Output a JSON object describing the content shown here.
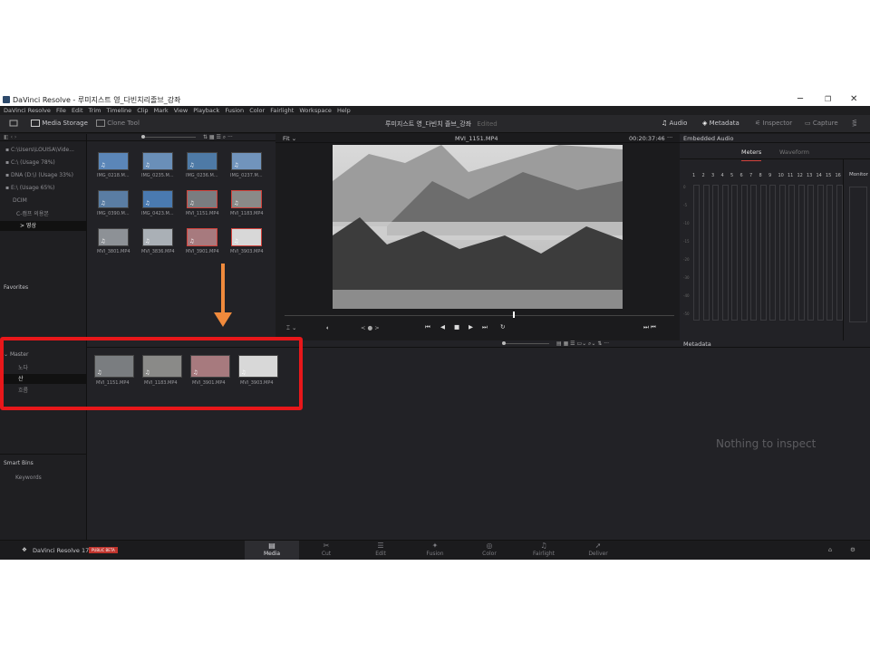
{
  "window": {
    "title": "DaVinci Resolve - 루미지스트 영_다빈치리졸브_강좌",
    "controls": {
      "minimize": "─",
      "maximize": "❐",
      "close": "✕"
    }
  },
  "menu": [
    "DaVinci Resolve",
    "File",
    "Edit",
    "Trim",
    "Timeline",
    "Clip",
    "Mark",
    "View",
    "Playback",
    "Fusion",
    "Color",
    "Fairlight",
    "Workspace",
    "Help"
  ],
  "toolbar": {
    "media_storage": "Media Storage",
    "clone_tool": "Clone Tool",
    "project_title": "루미지스트 영_다빈치 졸브_강좌",
    "edited": "Edited",
    "audio": "Audio",
    "metadata": "Metadata",
    "inspector": "Inspector",
    "capture": "Capture"
  },
  "storage_tree": [
    {
      "label": "C:\\Users\\LOUISA\\Vide...",
      "icon": "drive-icon"
    },
    {
      "label": "C:\\ (Usage 78%)",
      "icon": "drive-icon"
    },
    {
      "label": "DNA (D:\\) (Usage 33%)",
      "icon": "drive-icon"
    },
    {
      "label": "E:\\ (Usage 65%)",
      "icon": "drive-icon"
    },
    {
      "label": "DCIM",
      "icon": "folder-icon"
    },
    {
      "label": "C-캠프 의용본",
      "icon": "folder-icon"
    },
    {
      "label": "> 영상",
      "icon": "folder-icon"
    }
  ],
  "favorites_label": "Favorites",
  "media_files": [
    {
      "name": "IMG_0218.M...",
      "selected": false,
      "tone": "#5b86b8"
    },
    {
      "name": "IMG_0235.M...",
      "selected": false,
      "tone": "#6a8fb8"
    },
    {
      "name": "IMG_0236.M...",
      "selected": false,
      "tone": "#4e7aa6"
    },
    {
      "name": "IMG_0237.M...",
      "selected": false,
      "tone": "#7194bc"
    },
    {
      "name": "IMG_0390.M...",
      "selected": false,
      "tone": "#5a7da3"
    },
    {
      "name": "IMG_0423.M...",
      "selected": false,
      "tone": "#4a7ab0"
    },
    {
      "name": "MVI_1151.MP4",
      "selected": true,
      "tone": "#7a7d80"
    },
    {
      "name": "MVI_1183.MP4",
      "selected": true,
      "tone": "#8a8a88"
    },
    {
      "name": "MVI_3801.MP4",
      "selected": false,
      "tone": "#8d9196"
    },
    {
      "name": "MVI_3836.MP4",
      "selected": false,
      "tone": "#aab0b6"
    },
    {
      "name": "MVI_3901.MP4",
      "selected": true,
      "tone": "#a77a7e"
    },
    {
      "name": "MVI_3903.MP4",
      "selected": true,
      "tone": "#d8d8d8"
    }
  ],
  "viewer": {
    "fit": "Fit",
    "clip_name": "MVI_1151.MP4",
    "timecode": "00:20:37:46",
    "transport": [
      "⏮",
      "◀",
      "■",
      "▶",
      "⏭",
      "↻"
    ],
    "frame": "< ● >"
  },
  "audio_panel": {
    "title": "Embedded Audio",
    "tabs": [
      "Meters",
      "Waveform"
    ],
    "monitor": "Monitor",
    "channels": [
      "1",
      "2",
      "3",
      "4",
      "5",
      "6",
      "7",
      "8",
      "9",
      "10",
      "11",
      "12",
      "13",
      "14",
      "15",
      "16"
    ],
    "scale": [
      "0",
      "-5",
      "-10",
      "-15",
      "-20",
      "-30",
      "-40",
      "-50"
    ]
  },
  "bins": {
    "master": "Master",
    "children": [
      "노다",
      "산",
      "흐름"
    ]
  },
  "smart_bins": {
    "label": "Smart Bins",
    "keywords": "Keywords"
  },
  "bin_clips": [
    {
      "name": "MVI_1151.MP4",
      "tone": "#7a7d80"
    },
    {
      "name": "MVI_1183.MP4",
      "tone": "#8a8a88"
    },
    {
      "name": "MVI_3901.MP4",
      "tone": "#a77a7e"
    },
    {
      "name": "MVI_3903.MP4",
      "tone": "#d8d8d8"
    }
  ],
  "metadata_panel": {
    "title": "Metadata",
    "empty": "Nothing to inspect"
  },
  "bottom": {
    "app_name": "DaVinci Resolve 17",
    "badge": "PUBLIC BETA",
    "pages": [
      {
        "label": "Media",
        "icon": "▤",
        "active": true
      },
      {
        "label": "Cut",
        "icon": "✂",
        "active": false
      },
      {
        "label": "Edit",
        "icon": "☰",
        "active": false
      },
      {
        "label": "Fusion",
        "icon": "✦",
        "active": false
      },
      {
        "label": "Color",
        "icon": "◎",
        "active": false
      },
      {
        "label": "Fairlight",
        "icon": "♫",
        "active": false
      },
      {
        "label": "Deliver",
        "icon": "➚",
        "active": false
      }
    ]
  },
  "annotation": {
    "highlight_color": "#e8171a",
    "arrow_color": "#f08a3c"
  }
}
